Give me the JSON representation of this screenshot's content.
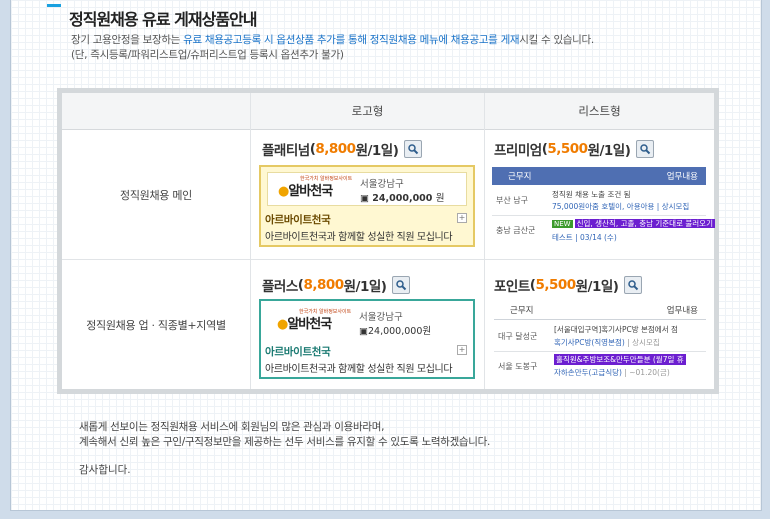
{
  "header": {
    "title": "정직원채용 유료 게재상품안내"
  },
  "description": {
    "line1_prefix": "장기 고용안정을 보장하는 ",
    "line1_highlight": "유료 채용공고등록 시 옵션상품 추가를 통해 정직원채용 메뉴에 채용공고를 게재",
    "line1_suffix": "시킬 수 있습니다.",
    "line2": "(단, 즉시등록/파워리스트업/슈퍼리스트업 등록시 옵션추가 불가)"
  },
  "table": {
    "col_logo": "로고형",
    "col_list": "리스트형",
    "row1_label": "정직원채용 메인",
    "row2_label": "정직원채용 업 · 직종별+지역별"
  },
  "products": {
    "platinum": {
      "name": "플래티넘",
      "open": " (",
      "price": "8,800",
      "unit": "원/1일)"
    },
    "premium": {
      "name": "프리미엄",
      "open": " (",
      "price": "5,500",
      "unit": "원/1일)"
    },
    "plus": {
      "name": "플러스",
      "open": " (",
      "price": "8,800",
      "unit": "원/1일)"
    },
    "point": {
      "name": "포인트",
      "open": " (",
      "price": "5,500",
      "unit": "원/1일)"
    }
  },
  "sample_card": {
    "logo_small": "한국가치 알바정보사이트",
    "logo_text": "알바천국",
    "location": "서울강남구",
    "salary": "24,000,000",
    "salary_unit": "원",
    "company": "아르바이트천국",
    "slogan": "아르바이트천국과 함께할 성실한 직원 모십니다",
    "plus_symbol": "+"
  },
  "premium_sample": {
    "head_region": "근무지",
    "head_job": "업무내용",
    "row1_region": "부산 남구",
    "row1_title": "정직원 채용 노출 조건 됨",
    "row1_sub": "75,000원아줌 호텔이, 아용아용 | 상시모집",
    "row2_region": "충남 금산군",
    "row2_tag": "NEW",
    "row2_title": "신입, 생산직, 고졸, 충남 기준대로 불러오기",
    "row2_sub": "테스트 | 03/14 (수)"
  },
  "point_sample": {
    "head_region": "근무지",
    "head_job": "업무내용",
    "row1_region": "대구 달성군",
    "row1_title": "[서울대입구역]혹기사PC방 본점에서 점",
    "row1_sub": "혹기사PC방(직영본점)",
    "row1_sub2": "| 상시모집",
    "row2_region": "서울 도봉구",
    "row2_title": "홀직원&주방보조&만두만들분 (월7일 휴",
    "row2_sub": "자하손만두(고급식당)",
    "row2_sub2": "| ~01.20(금)"
  },
  "footer": {
    "line1": "새롭게 선보이는 정직원채용 서비스에 회원님의 많은 관심과 이용바라며,",
    "line2": "계속해서 신뢰 높은 구인/구직정보만을 제공하는 선두 서비스를 유지할 수 있도록 노력하겠습니다.",
    "thanks": "감사합니다."
  },
  "icons": {
    "zoom": "magnifier-icon",
    "bullet": "title-bar-icon"
  },
  "colors": {
    "price": "#f07c00",
    "highlight": "#1a73c8",
    "gold_border": "#e5c964",
    "teal_border": "#39a79a",
    "premium_header": "#4f6fb2"
  }
}
